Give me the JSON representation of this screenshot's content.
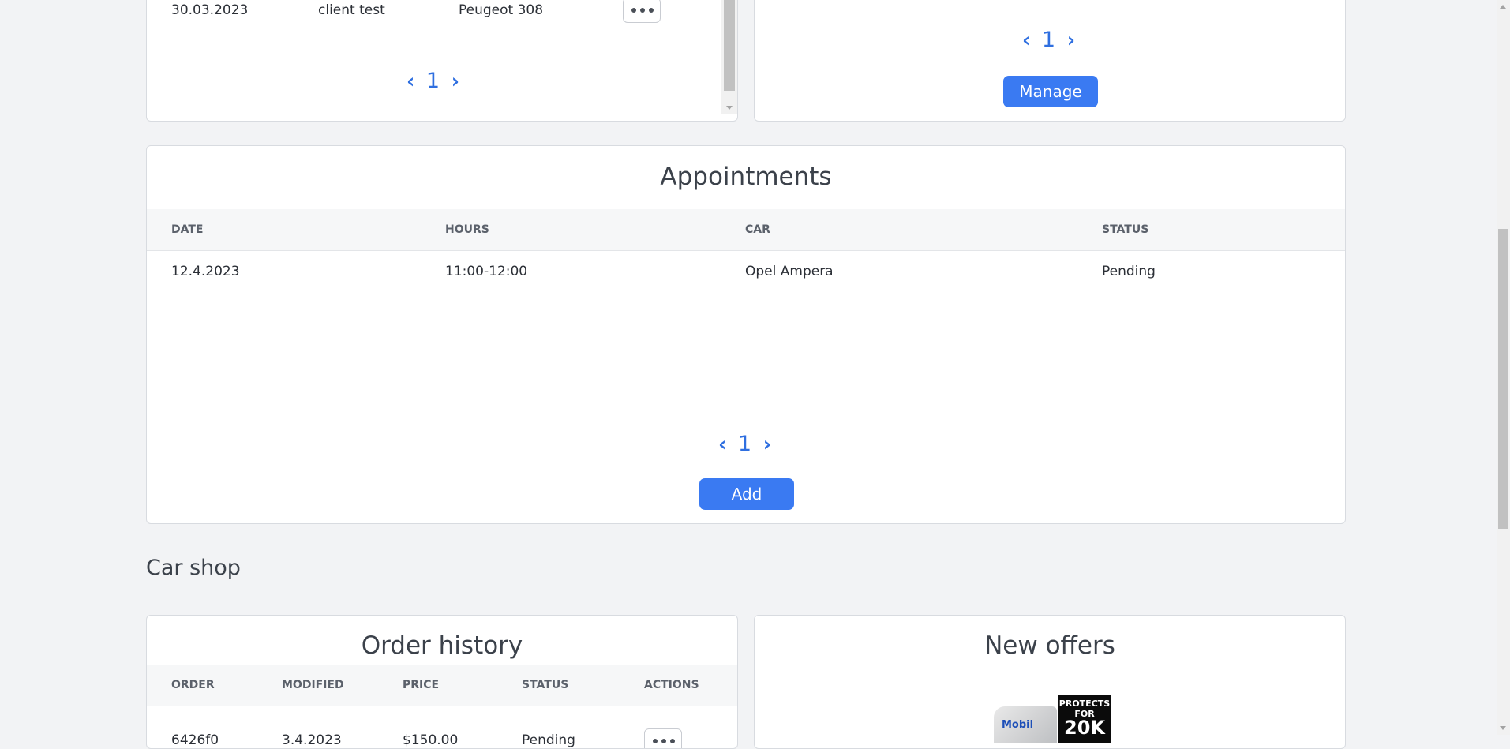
{
  "vehicles_card": {
    "row": {
      "date": "30.03.2023",
      "client": "client test",
      "car": "Peugeot 308"
    },
    "pager": {
      "prev": "‹",
      "page": "1",
      "next": "›"
    }
  },
  "manage_card": {
    "pager": {
      "prev": "‹",
      "page": "1",
      "next": "›"
    },
    "manage_label": "Manage"
  },
  "appointments": {
    "title": "Appointments",
    "columns": [
      "DATE",
      "HOURS",
      "CAR",
      "STATUS"
    ],
    "rows": [
      {
        "date": "12.4.2023",
        "hours": "11:00-12:00",
        "car": "Opel Ampera",
        "status": "Pending"
      }
    ],
    "pager": {
      "prev": "‹",
      "page": "1",
      "next": "›"
    },
    "add_label": "Add"
  },
  "car_shop": {
    "heading": "Car shop",
    "order_history": {
      "title": "Order history",
      "columns": [
        "ORDER",
        "MODIFIED",
        "PRICE",
        "STATUS",
        "ACTIONS"
      ],
      "partial_row": {
        "order": "6426f0",
        "modified": "3.4.2023",
        "price": "$150.00",
        "status": "Pending"
      }
    },
    "new_offers": {
      "title": "New offers",
      "product_brand": "Mobil",
      "product_banner_line1": "PROTECTS",
      "product_banner_line2": "FOR",
      "product_banner_line3": "20K"
    }
  },
  "colors": {
    "accent": "#3a7af2",
    "link": "#2f6fe0",
    "background": "#f2f3f5"
  }
}
